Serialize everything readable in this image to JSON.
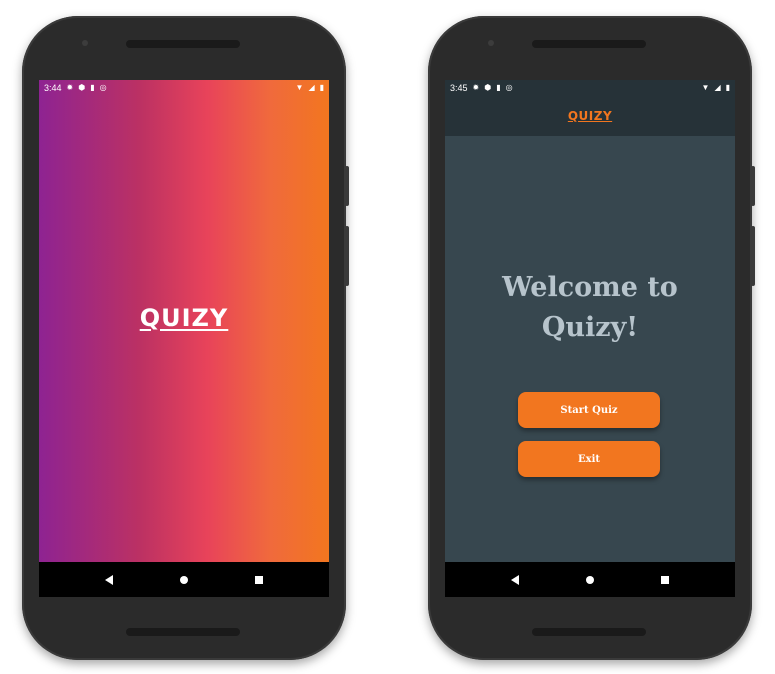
{
  "splash_screen": {
    "status_bar": {
      "time": "3:44",
      "left_icons": [
        "gear-icon",
        "shield-icon",
        "sd-card-icon",
        "sync-icon"
      ],
      "right_icons": [
        "wifi-icon",
        "signal-icon",
        "battery-icon"
      ]
    },
    "logo": "QUIZY",
    "gradient_colors": [
      "#8e2392",
      "#e8435a",
      "#f2761f"
    ]
  },
  "home_screen": {
    "status_bar": {
      "time": "3:45",
      "left_icons": [
        "gear-icon",
        "shield-icon",
        "sd-card-icon",
        "sync-icon"
      ],
      "right_icons": [
        "wifi-icon",
        "signal-icon",
        "battery-icon"
      ]
    },
    "app_bar_title": "QUIZY",
    "welcome_line1": "Welcome to",
    "welcome_line2": "Quizy!",
    "buttons": {
      "start_label": "Start Quiz",
      "exit_label": "Exit"
    },
    "colors": {
      "background": "#37474f",
      "app_bar": "#263238",
      "accent": "#f2761f",
      "welcome_text": "#b7c4cc"
    }
  },
  "nav_bar": {
    "icons": [
      "back-icon",
      "home-icon",
      "recents-icon"
    ]
  }
}
